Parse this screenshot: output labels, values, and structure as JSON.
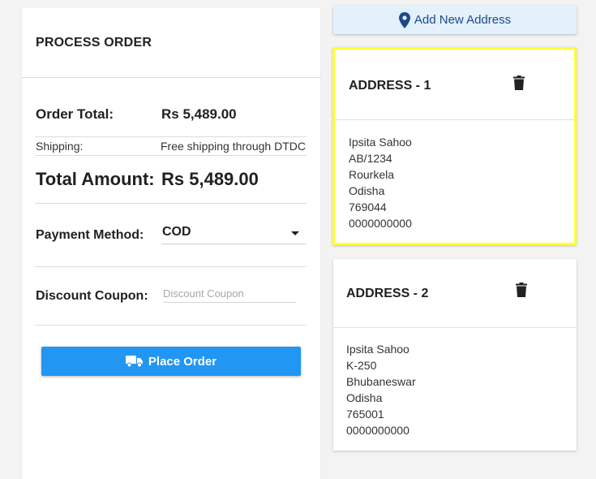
{
  "process_order": {
    "title": "PROCESS ORDER",
    "order_total_label": "Order Total:",
    "order_total_value": "Rs 5,489.00",
    "shipping_label": "Shipping:",
    "shipping_value": "Free shipping through DTDC",
    "total_amount_label": "Total Amount:",
    "total_amount_value": "Rs 5,489.00",
    "payment_method_label": "Payment Method:",
    "payment_method_value": "COD",
    "discount_label": "Discount Coupon:",
    "discount_placeholder": "Discount Coupon",
    "discount_value": "",
    "place_order_label": "Place Order"
  },
  "add_address_label": "Add New Address",
  "addresses": [
    {
      "title": "ADDRESS - 1",
      "selected": true,
      "name": "Ipsita Sahoo",
      "line1": "AB/1234",
      "city": "Rourkela",
      "state": "Odisha",
      "pin": "769044",
      "phone": "0000000000"
    },
    {
      "title": "ADDRESS - 2",
      "selected": false,
      "name": "Ipsita Sahoo",
      "line1": "K-250",
      "city": "Bhubaneswar",
      "state": "Odisha",
      "pin": "765001",
      "phone": "0000000000"
    }
  ],
  "colors": {
    "primary_button": "#2196f3",
    "add_button_bg": "#e3f1fd",
    "add_button_text": "#1e4a86",
    "selected_border": "#ffff33"
  },
  "icons": {
    "place_order": "truck-icon",
    "add_address": "map-pin-icon",
    "delete": "trash-icon"
  }
}
